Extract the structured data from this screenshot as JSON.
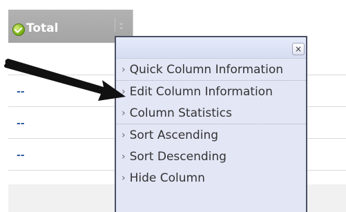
{
  "grid": {
    "column_header": {
      "label": "Total",
      "status_icon": "checkmark-icon",
      "menu_icon": "chevron-down-icon",
      "menu_glyph": "❯❯"
    },
    "rows": [
      {
        "value": ""
      },
      {
        "value": "--"
      },
      {
        "value": "--"
      },
      {
        "value": "--"
      }
    ]
  },
  "context_menu": {
    "close_label": "×",
    "arrow_glyph": "›",
    "sections": [
      {
        "items": [
          "Quick Column Information"
        ]
      },
      {
        "items": [
          "Edit Column Information",
          "Column Statistics"
        ]
      },
      {
        "items": [
          "Sort Ascending",
          "Sort Descending",
          "Hide Column"
        ]
      }
    ]
  },
  "colors": {
    "header_bg": "#a9a9a9",
    "menu_bg": "#e3e6f5",
    "menu_border": "#4a4f63",
    "link_blue": "#2b58a6",
    "arrow": "#111111"
  }
}
